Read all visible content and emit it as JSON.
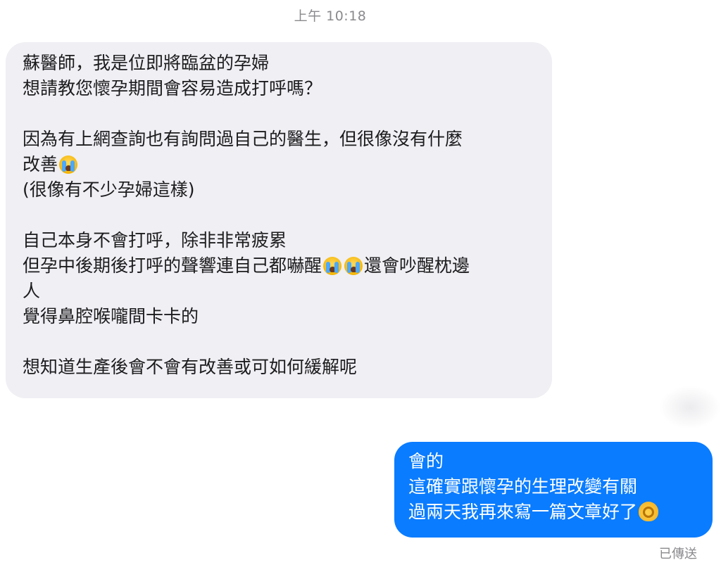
{
  "header": {
    "timestamp": "上午 10:18"
  },
  "messages": {
    "incoming": {
      "lines": [
        "蘇醫師，我是位即將臨盆的孕婦",
        "想請教您懷孕期間會容易造成打呼嗎？",
        "",
        "因為有上網查詢也有詢問過自己的醫生，但很像沒有什麼",
        "改善",
        "(很像有不少孕婦這樣)",
        "",
        "自己本身不會打呼，除非非常疲累",
        "但孕中後期後打呼的聲響連自己都嚇醒",
        "還會吵醒枕邊",
        "人",
        "覺得鼻腔喉嚨間卡卡的",
        "",
        "想知道生產後會不會有改善或可如何緩解呢"
      ],
      "emoji_names": [
        "loudly-crying-face-icon",
        "loudly-crying-face-icon",
        "loudly-crying-face-icon"
      ]
    },
    "outgoing": {
      "lines": [
        "會的",
        "這確實跟懷孕的生理改變有關",
        "過兩天我再來寫一篇文章好了"
      ],
      "emoji_names": [
        "ok-hand-icon"
      ],
      "status": "已傳送"
    }
  },
  "colors": {
    "incoming_bubble": "#efeff4",
    "outgoing_bubble": "#0a7cff",
    "outgoing_text": "#ffffff",
    "meta_text": "#8a8a8e"
  }
}
